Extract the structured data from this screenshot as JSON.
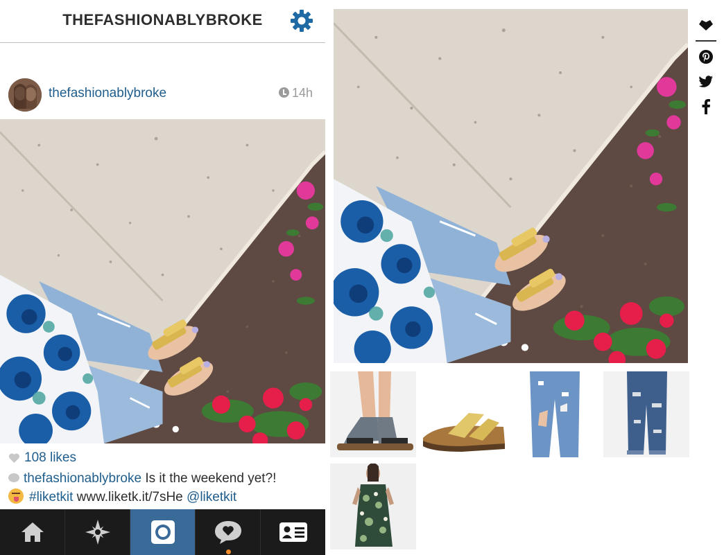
{
  "app": {
    "header_title": "THEFASHIONABLYBROKE"
  },
  "post": {
    "username": "thefashionablybroke",
    "time": "14h",
    "likes": "108 likes",
    "caption_user": "thefashionablybroke",
    "caption_text": "Is it the weekend yet?!",
    "caption_hashtag": "#liketkit",
    "caption_link": "www.liketk.it/7sHe",
    "caption_mention": "@liketkit"
  },
  "icons": {
    "header": "gear-icon",
    "time": "clock-icon",
    "likes": "heart-icon",
    "comment": "comment-bubble-icon",
    "emoji": "tongue-out-emoji-icon"
  },
  "tabbar": {
    "tabs": [
      "home-icon",
      "explore-icon",
      "camera-icon",
      "activity-icon",
      "profile-icon"
    ],
    "active_index": 2
  },
  "share": {
    "buttons": [
      "liketoknowit-heart-icon",
      "pinterest-icon",
      "twitter-icon",
      "facebook-icon"
    ]
  },
  "products": [
    "socks-and-sandals",
    "gold-buckle-sandal",
    "distressed-light-jeans",
    "distressed-boyfriend-jeans",
    "floral-sleeveless-dress"
  ],
  "colors": {
    "link_blue": "#1f5d8c",
    "tabbar_bg": "#1b1b1b",
    "tab_active": "#3a6a97",
    "notification_dot": "#f28b2a",
    "gear_blue": "#1f6aa5"
  }
}
